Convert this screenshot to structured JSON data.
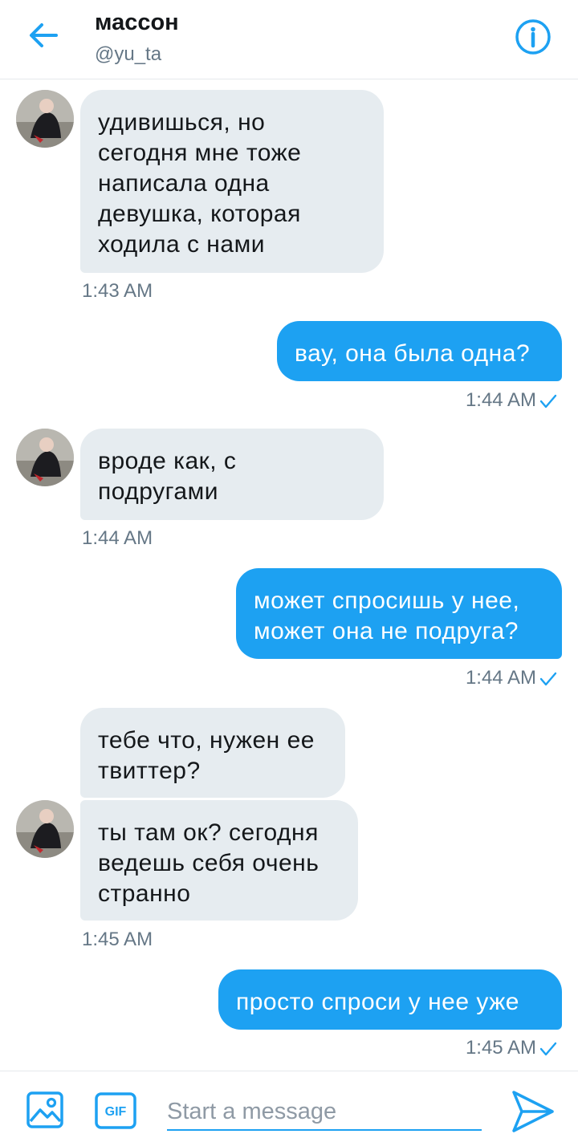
{
  "header": {
    "title": "массон",
    "handle": "@yu_ta"
  },
  "messages": [
    {
      "text": "удивишься, но\nсегодня мне тоже\nнаписала одна\nдевушка, которая\nходила с нами",
      "time": "1:43 AM"
    },
    {
      "text": "вау, она была одна?",
      "time": "1:44 AM"
    },
    {
      "text": "вроде как, с\nподругами",
      "time": "1:44 AM"
    },
    {
      "text": "может спросишь у нее,\nможет она не подруга?",
      "time": "1:44 AM"
    },
    {
      "text": "тебе что, нужен ее\nтвиттер?"
    },
    {
      "text": "ты там ок? сегодня\nведешь себя очень\nстранно",
      "time": "1:45 AM"
    },
    {
      "text": "просто спроси у нее уже",
      "time": "1:45 AM"
    }
  ],
  "composer": {
    "placeholder": "Start a message",
    "gif_label": "GIF"
  },
  "colors": {
    "accent": "#1da1f2",
    "incoming_bubble": "#e6ecf0",
    "timestamp": "#657786"
  }
}
